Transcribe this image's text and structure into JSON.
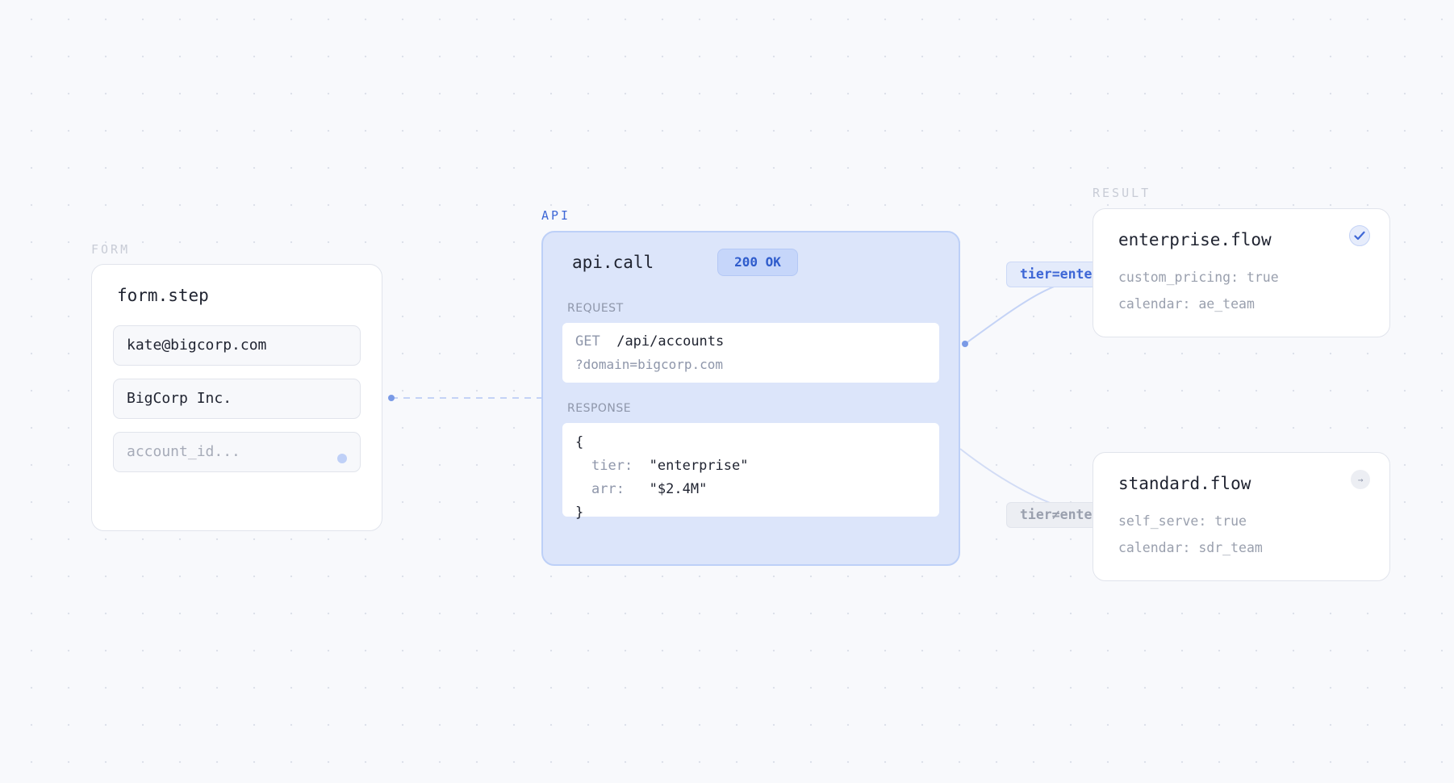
{
  "sections": {
    "form": "FORM",
    "api": "API",
    "result": "RESULT"
  },
  "form_node": {
    "title": "form.step",
    "fields": [
      {
        "value": "kate@bigcorp.com"
      },
      {
        "value": "BigCorp Inc."
      },
      {
        "placeholder": "account_id..."
      }
    ]
  },
  "api_node": {
    "title": "api.call",
    "status": "200 OK",
    "request_label": "REQUEST",
    "request": {
      "method": "GET",
      "path": "/api/accounts",
      "query": "?domain=bigcorp.com"
    },
    "response_label": "RESPONSE",
    "response": {
      "open": "{",
      "fields": [
        {
          "key": "tier:",
          "value": "\"enterprise\""
        },
        {
          "key": "arr:",
          "value": "\"$2.4M\""
        }
      ],
      "close": "}"
    }
  },
  "edges": {
    "yes_label": "tier=enterprise",
    "no_label": "tier≠enterprise"
  },
  "results": [
    {
      "title": "enterprise.flow",
      "props": [
        "custom_pricing: true",
        "calendar: ae_team"
      ],
      "icon": "check-icon"
    },
    {
      "title": "standard.flow",
      "props": [
        "self_serve: true",
        "calendar: sdr_team"
      ],
      "icon": "arrow-right-icon",
      "icon_glyph": "→"
    }
  ],
  "colors": {
    "accent": "#3e67d6",
    "api_fill": "#dce5fa",
    "edge": "#c4d3f6"
  }
}
